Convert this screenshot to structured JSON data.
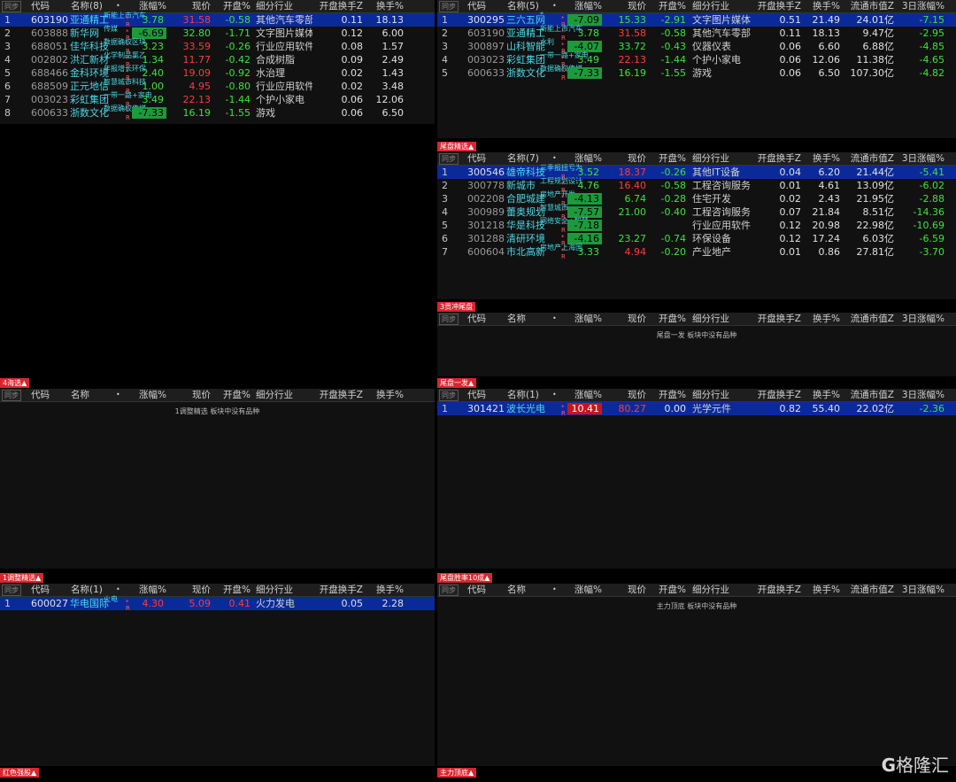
{
  "sync_label": "同步",
  "logo_text": "格隆汇",
  "cols": {
    "code": "代码",
    "chg": "涨幅%",
    "price": "现价",
    "open": "开盘%",
    "industry": "细分行业",
    "open_turn": "开盘换手Z",
    "turn": "换手%",
    "mcap": "流通市值Z",
    "chg3": "3日涨幅%"
  },
  "empty_text": "板块中没有品种",
  "panels": {
    "p1": {
      "name_header": "名称(8)",
      "rows": [
        {
          "idx": "1",
          "code": "603190",
          "name": "亚通精工",
          "concept": "新能上市汽车",
          "chg": "3.78",
          "price": "31.58",
          "open": "-0.58",
          "industry": "其他汽车零部件",
          "open_turn": "0.11",
          "turn": "18.13"
        },
        {
          "idx": "2",
          "code": "603888",
          "name": "新华网",
          "concept": "传媒",
          "chg": "-6.69",
          "price": "32.80",
          "open": "-1.71",
          "industry": "文字图片媒体",
          "open_turn": "0.12",
          "turn": "6.00"
        },
        {
          "idx": "3",
          "code": "688051",
          "name": "佳华科技",
          "concept": "数据确权区块",
          "chg": "3.23",
          "price": "33.59",
          "open": "-0.26",
          "industry": "行业应用软件",
          "open_turn": "0.08",
          "turn": "1.57"
        },
        {
          "idx": "4",
          "code": "002802",
          "name": "洪汇新材",
          "concept": "化学制品氯乙",
          "chg": "1.34",
          "price": "11.77",
          "open": "-0.42",
          "industry": "合成树脂",
          "open_turn": "0.09",
          "turn": "2.49"
        },
        {
          "idx": "5",
          "code": "688466",
          "name": "金科环境",
          "concept": "年报增长环保",
          "chg": "2.40",
          "price": "19.09",
          "open": "-0.92",
          "industry": "水治理",
          "open_turn": "0.02",
          "turn": "1.43"
        },
        {
          "idx": "6",
          "code": "688509",
          "name": "正元地信",
          "concept": "智慧城市科技",
          "chg": "1.00",
          "price": "4.95",
          "open": "-0.80",
          "industry": "行业应用软件",
          "open_turn": "0.02",
          "turn": "3.48"
        },
        {
          "idx": "7",
          "code": "003023",
          "name": "彩虹集团",
          "concept": "一带一路+家电",
          "chg": "3.49",
          "price": "22.13",
          "open": "-1.44",
          "industry": "个护小家电",
          "open_turn": "0.06",
          "turn": "12.06"
        },
        {
          "idx": "8",
          "code": "600633",
          "name": "浙数文化",
          "concept": "数据确权传媒",
          "chg": "-7.33",
          "price": "16.19",
          "open": "-1.55",
          "industry": "游戏",
          "open_turn": "0.06",
          "turn": "6.50"
        }
      ]
    },
    "p2": {
      "name_header": "名称(5)",
      "rows": [
        {
          "idx": "1",
          "code": "300295",
          "name": "三六五网",
          "concept": "*",
          "chg": "-7.09",
          "price": "15.33",
          "open": "-2.91",
          "industry": "文字图片媒体",
          "open_turn": "0.51",
          "turn": "21.49",
          "mcap": "24.01亿",
          "chg3": "-7.15"
        },
        {
          "idx": "2",
          "code": "603190",
          "name": "亚通精工",
          "concept": "新能上市汽车",
          "chg": "3.78",
          "price": "31.58",
          "open": "-0.58",
          "industry": "其他汽车零部件",
          "open_turn": "0.11",
          "turn": "18.13",
          "mcap": "9.47亿",
          "chg3": "-2.95"
        },
        {
          "idx": "3",
          "code": "300897",
          "name": "山科智能",
          "concept": "水利",
          "chg": "-4.07",
          "price": "33.72",
          "open": "-0.43",
          "industry": "仪器仪表",
          "open_turn": "0.06",
          "turn": "6.60",
          "mcap": "6.88亿",
          "chg3": "-4.85"
        },
        {
          "idx": "4",
          "code": "003023",
          "name": "彩虹集团",
          "concept": "一带一路+家电",
          "chg": "3.49",
          "price": "22.13",
          "open": "-1.44",
          "industry": "个护小家电",
          "open_turn": "0.06",
          "turn": "12.06",
          "mcap": "11.38亿",
          "chg3": "-4.65"
        },
        {
          "idx": "5",
          "code": "600633",
          "name": "浙数文化",
          "concept": "数据确权传媒",
          "chg": "-7.33",
          "price": "16.19",
          "open": "-1.55",
          "industry": "游戏",
          "open_turn": "0.06",
          "turn": "6.50",
          "mcap": "107.30亿",
          "chg3": "-4.82"
        }
      ]
    },
    "p3": {
      "tag": "尾盘精选▲",
      "name_header": "名称(7)",
      "rows": [
        {
          "idx": "1",
          "code": "300546",
          "name": "雄帝科技",
          "concept": "三季报扭亏为",
          "chg": "3.52",
          "price": "18.37",
          "open": "-0.26",
          "industry": "其他IT设备",
          "open_turn": "0.04",
          "turn": "6.20",
          "mcap": "21.44亿",
          "chg3": "-5.41"
        },
        {
          "idx": "2",
          "code": "300778",
          "name": "新城市",
          "concept": "工程规划设计",
          "chg": "4.76",
          "price": "16.40",
          "open": "-0.58",
          "industry": "工程咨询服务",
          "open_turn": "0.01",
          "turn": "4.61",
          "mcap": "13.09亿",
          "chg3": "-6.02"
        },
        {
          "idx": "3",
          "code": "002208",
          "name": "合肥城建",
          "concept": "房地产开发",
          "chg": "-4.13",
          "price": "6.74",
          "open": "-0.28",
          "industry": "住宅开发",
          "open_turn": "0.02",
          "turn": "2.43",
          "mcap": "21.95亿",
          "chg3": "-2.88"
        },
        {
          "idx": "4",
          "code": "300989",
          "name": "蕾奥规划",
          "concept": "智慧城市",
          "chg": "-7.57",
          "price": "21.00",
          "open": "-0.40",
          "industry": "工程咨询服务",
          "open_turn": "0.07",
          "turn": "21.84",
          "mcap": "8.51亿",
          "chg3": "-14.36"
        },
        {
          "idx": "5",
          "code": "301218",
          "name": "华是科技",
          "concept": "网络安全+智慧",
          "chg": "-7.18",
          "price": "",
          "open": "",
          "industry": "行业应用软件",
          "open_turn": "0.12",
          "turn": "20.98",
          "mcap": "22.98亿",
          "chg3": "-10.69"
        },
        {
          "idx": "6",
          "code": "301288",
          "name": "清研环境",
          "concept": "",
          "chg": "-4.16",
          "price": "23.27",
          "open": "-0.74",
          "industry": "环保设备",
          "open_turn": "0.12",
          "turn": "17.24",
          "mcap": "6.03亿",
          "chg3": "-6.59"
        },
        {
          "idx": "7",
          "code": "600604",
          "name": "市北高新",
          "concept": "房地产上海国",
          "chg": "3.33",
          "price": "4.94",
          "open": "-0.20",
          "industry": "产业地产",
          "open_turn": "0.01",
          "turn": "0.86",
          "mcap": "27.81亿",
          "chg3": "-3.70"
        }
      ]
    },
    "p4": {
      "tag": "3贡冲尾盘",
      "name_header": "名称",
      "empty_prefix": "尾盘一发"
    },
    "p5": {
      "tag": "4海选▲",
      "name_header": "名称",
      "empty_prefix": "1调整精选"
    },
    "p6": {
      "tag": "尾盘一发▲",
      "name_header": "名称(1)",
      "rows": [
        {
          "idx": "1",
          "code": "301421",
          "name": "波长光电",
          "chg": "10.41",
          "price": "80.27",
          "open": "0.00",
          "industry": "光学元件",
          "open_turn": "0.82",
          "turn": "55.40",
          "mcap": "22.02亿",
          "chg3": "-2.36"
        }
      ]
    },
    "p7": {
      "tag": "1调整精选▲",
      "name_header": "名称(1)",
      "rows": [
        {
          "idx": "1",
          "code": "600027",
          "name": "华电国际",
          "concept": "火电",
          "chg": "4.30",
          "price": "5.09",
          "open": "0.41",
          "industry": "火力发电",
          "open_turn": "0.05",
          "turn": "2.28"
        }
      ]
    },
    "p8": {
      "tag": "尾盘胜率10成▲",
      "name_header": "名称",
      "empty_prefix": "主力顶底"
    },
    "p9": {
      "tag": "红色强股▲"
    },
    "p10": {
      "tag": "主力顶底▲"
    }
  }
}
